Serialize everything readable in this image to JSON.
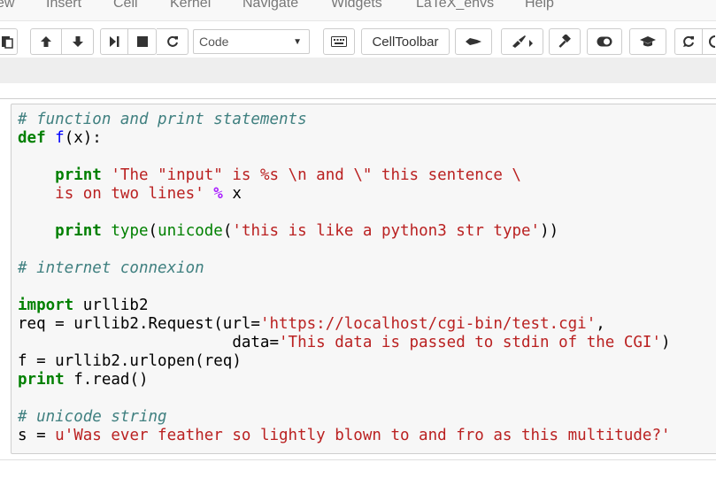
{
  "menubar": {
    "items": [
      "ew",
      "Insert",
      "Cell",
      "Kernel",
      "Navigate",
      "Widgets",
      "LaTeX_envs",
      "Help"
    ]
  },
  "toolbar": {
    "cell_type": "Code",
    "celltoolbar_label": "CellToolbar"
  },
  "code_cell": {
    "lines": [
      [
        {
          "t": "# function and print statements",
          "c": "cm"
        }
      ],
      [
        {
          "t": "def",
          "c": "kw"
        },
        {
          "t": " ",
          "c": "nm"
        },
        {
          "t": "f",
          "c": "fn"
        },
        {
          "t": "(x):",
          "c": "nm"
        }
      ],
      [],
      [
        {
          "t": "    ",
          "c": "nm"
        },
        {
          "t": "print",
          "c": "kw"
        },
        {
          "t": " ",
          "c": "nm"
        },
        {
          "t": "'The \"input\" is %s \\n and \\\" this sentence \\",
          "c": "str"
        }
      ],
      [
        {
          "t": "    ",
          "c": "nm"
        },
        {
          "t": "is on two lines'",
          "c": "str"
        },
        {
          "t": " ",
          "c": "nm"
        },
        {
          "t": "%",
          "c": "op"
        },
        {
          "t": " x",
          "c": "nm"
        }
      ],
      [],
      [
        {
          "t": "    ",
          "c": "nm"
        },
        {
          "t": "print",
          "c": "kw"
        },
        {
          "t": " ",
          "c": "nm"
        },
        {
          "t": "type",
          "c": "bi"
        },
        {
          "t": "(",
          "c": "nm"
        },
        {
          "t": "unicode",
          "c": "bi"
        },
        {
          "t": "(",
          "c": "nm"
        },
        {
          "t": "'this is like a python3 str type'",
          "c": "str"
        },
        {
          "t": "))",
          "c": "nm"
        }
      ],
      [],
      [
        {
          "t": "# internet connexion",
          "c": "cm"
        }
      ],
      [],
      [
        {
          "t": "import",
          "c": "kw"
        },
        {
          "t": " urllib2",
          "c": "nm"
        }
      ],
      [
        {
          "t": "req = urllib2.Request(url=",
          "c": "nm"
        },
        {
          "t": "'https://localhost/cgi-bin/test.cgi'",
          "c": "str"
        },
        {
          "t": ",",
          "c": "nm"
        }
      ],
      [
        {
          "t": "                       data=",
          "c": "nm"
        },
        {
          "t": "'This data is passed to stdin of the CGI'",
          "c": "str"
        },
        {
          "t": ")",
          "c": "nm"
        }
      ],
      [
        {
          "t": "f = urllib2.urlopen(req)",
          "c": "nm"
        }
      ],
      [
        {
          "t": "print",
          "c": "kw"
        },
        {
          "t": " f.read()",
          "c": "nm"
        }
      ],
      [],
      [
        {
          "t": "# unicode string",
          "c": "cm"
        }
      ],
      [
        {
          "t": "s = ",
          "c": "nm"
        },
        {
          "t": "u'Was ever feather so lightly blown to and fro as this multitude?'",
          "c": "str"
        }
      ]
    ]
  }
}
